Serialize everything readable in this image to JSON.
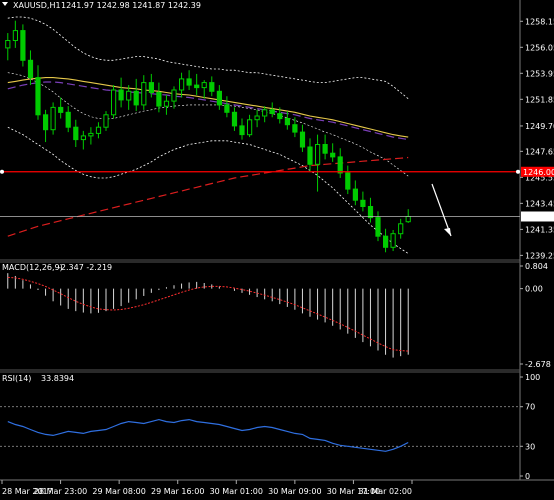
{
  "header": {
    "title": "XAUUSD,H1",
    "ohlc": "1241.97 1242.98 1241.87 1242.39"
  },
  "colors": {
    "background": "#000000",
    "bull": "#00cc00",
    "bear": "#00cc00",
    "ma_fast": "#e6c84a",
    "ma_mid": "#7a3fb8",
    "ma_slow": "#dc1e1e",
    "bands": "#ffffff",
    "support_line": "#ff0000",
    "current_line": "#bbbbbb",
    "rsi": "#2f6fe0",
    "macd_signal": "#ff3030"
  },
  "chart_data": [
    {
      "type": "candlestick",
      "symbol": "XAUUSD",
      "timeframe": "H1",
      "ylim": [
        1239.2,
        1258.9
      ],
      "y_ticks": [
        "1258.15",
        "1256.05",
        "1253.95",
        "1251.85",
        "1249.70",
        "1247.65",
        "1245.55",
        "1243.45",
        "1241.35",
        "1239.25"
      ],
      "x_labels": [
        "28 Mar 2017",
        "28 Mar 23:00",
        "29 Mar 08:00",
        "29 Mar 16:00",
        "30 Mar 01:00",
        "30 Mar 09:00",
        "30 Mar 17:00",
        "31 Mar 02:00"
      ],
      "candles": [
        [
          1256.0,
          1257.2,
          1255.0,
          1256.6
        ],
        [
          1256.6,
          1258.2,
          1256.0,
          1257.4
        ],
        [
          1257.4,
          1257.9,
          1254.5,
          1255.0
        ],
        [
          1255.0,
          1255.8,
          1253.0,
          1253.6
        ],
        [
          1253.6,
          1254.6,
          1250.2,
          1250.6
        ],
        [
          1250.6,
          1251.0,
          1248.4,
          1249.4
        ],
        [
          1249.4,
          1251.6,
          1249.0,
          1251.2
        ],
        [
          1251.2,
          1252.0,
          1250.3,
          1250.8
        ],
        [
          1250.8,
          1251.3,
          1249.2,
          1249.6
        ],
        [
          1249.6,
          1250.2,
          1248.0,
          1248.6
        ],
        [
          1248.6,
          1249.3,
          1247.8,
          1248.9
        ],
        [
          1248.9,
          1249.6,
          1248.2,
          1249.1
        ],
        [
          1249.1,
          1250.0,
          1248.7,
          1249.6
        ],
        [
          1249.6,
          1250.9,
          1249.3,
          1250.6
        ],
        [
          1250.6,
          1253.0,
          1250.3,
          1252.6
        ],
        [
          1252.6,
          1253.6,
          1251.2,
          1251.8
        ],
        [
          1251.8,
          1253.0,
          1251.0,
          1252.5
        ],
        [
          1252.5,
          1253.5,
          1250.9,
          1251.4
        ],
        [
          1251.4,
          1253.8,
          1251.0,
          1253.2
        ],
        [
          1253.2,
          1253.9,
          1252.0,
          1252.4
        ],
        [
          1252.4,
          1253.2,
          1250.8,
          1251.3
        ],
        [
          1251.3,
          1252.2,
          1250.6,
          1251.7
        ],
        [
          1251.7,
          1252.9,
          1251.1,
          1252.6
        ],
        [
          1252.6,
          1254.0,
          1252.0,
          1253.5
        ],
        [
          1253.5,
          1254.2,
          1252.6,
          1253.0
        ],
        [
          1253.0,
          1253.9,
          1252.2,
          1252.8
        ],
        [
          1252.8,
          1253.4,
          1251.9,
          1253.2
        ],
        [
          1253.2,
          1253.7,
          1252.1,
          1252.5
        ],
        [
          1252.5,
          1253.0,
          1251.0,
          1251.4
        ],
        [
          1251.4,
          1252.1,
          1250.4,
          1250.8
        ],
        [
          1250.8,
          1251.2,
          1249.3,
          1249.7
        ],
        [
          1249.7,
          1250.3,
          1248.6,
          1249.0
        ],
        [
          1249.0,
          1250.6,
          1248.8,
          1250.2
        ],
        [
          1250.2,
          1251.0,
          1249.6,
          1250.5
        ],
        [
          1250.5,
          1251.3,
          1250.0,
          1251.0
        ],
        [
          1251.0,
          1251.6,
          1250.4,
          1250.7
        ],
        [
          1250.7,
          1251.2,
          1249.9,
          1250.3
        ],
        [
          1250.3,
          1250.9,
          1249.4,
          1249.8
        ],
        [
          1249.8,
          1250.4,
          1248.8,
          1249.2
        ],
        [
          1249.2,
          1249.8,
          1247.6,
          1248.0
        ],
        [
          1248.0,
          1248.7,
          1246.0,
          1246.6
        ],
        [
          1246.6,
          1249.0,
          1244.4,
          1248.2
        ],
        [
          1248.2,
          1249.0,
          1247.0,
          1247.5
        ],
        [
          1247.5,
          1248.3,
          1246.8,
          1247.2
        ],
        [
          1247.2,
          1247.9,
          1245.5,
          1245.9
        ],
        [
          1245.9,
          1246.5,
          1244.2,
          1244.6
        ],
        [
          1244.6,
          1245.3,
          1243.3,
          1243.7
        ],
        [
          1243.7,
          1244.4,
          1242.8,
          1243.2
        ],
        [
          1243.2,
          1243.9,
          1241.9,
          1242.3
        ],
        [
          1242.3,
          1242.8,
          1240.4,
          1240.8
        ],
        [
          1240.8,
          1241.4,
          1239.5,
          1239.9
        ],
        [
          1239.9,
          1241.3,
          1239.6,
          1241.0
        ],
        [
          1241.0,
          1242.2,
          1240.6,
          1241.8
        ],
        [
          1241.97,
          1242.98,
          1241.87,
          1242.39
        ]
      ],
      "ma_fast": [
        1253.2,
        1253.3,
        1253.4,
        1253.5,
        1253.55,
        1253.6,
        1253.6,
        1253.55,
        1253.5,
        1253.4,
        1253.3,
        1253.2,
        1253.1,
        1253.0,
        1252.9,
        1252.8,
        1252.75,
        1252.7,
        1252.6,
        1252.55,
        1252.5,
        1252.4,
        1252.3,
        1252.25,
        1252.2,
        1252.1,
        1252.0,
        1251.9,
        1251.8,
        1251.7,
        1251.6,
        1251.5,
        1251.4,
        1251.3,
        1251.2,
        1251.1,
        1251.0,
        1250.9,
        1250.8,
        1250.65,
        1250.5,
        1250.4,
        1250.3,
        1250.2,
        1250.05,
        1249.9,
        1249.75,
        1249.6,
        1249.45,
        1249.3,
        1249.15,
        1249.0,
        1248.9,
        1248.8
      ],
      "ma_mid": [
        1252.7,
        1252.85,
        1253.0,
        1253.1,
        1253.2,
        1253.25,
        1253.25,
        1253.2,
        1253.1,
        1253.0,
        1252.9,
        1252.8,
        1252.7,
        1252.6,
        1252.55,
        1252.5,
        1252.45,
        1252.4,
        1252.35,
        1252.3,
        1252.25,
        1252.2,
        1252.1,
        1252.05,
        1252.0,
        1251.9,
        1251.8,
        1251.7,
        1251.6,
        1251.5,
        1251.4,
        1251.3,
        1251.2,
        1251.1,
        1251.0,
        1250.9,
        1250.8,
        1250.7,
        1250.6,
        1250.45,
        1250.3,
        1250.2,
        1250.1,
        1250.0,
        1249.85,
        1249.7,
        1249.55,
        1249.4,
        1249.25,
        1249.1,
        1248.95,
        1248.8,
        1248.7,
        1248.6
      ],
      "ma_slow": [
        1240.8,
        1241.0,
        1241.2,
        1241.4,
        1241.6,
        1241.75,
        1241.9,
        1242.05,
        1242.2,
        1242.35,
        1242.5,
        1242.65,
        1242.8,
        1242.95,
        1243.1,
        1243.25,
        1243.4,
        1243.55,
        1243.7,
        1243.85,
        1244.0,
        1244.15,
        1244.3,
        1244.45,
        1244.6,
        1244.75,
        1244.9,
        1245.05,
        1245.2,
        1245.35,
        1245.5,
        1245.6,
        1245.7,
        1245.8,
        1245.9,
        1246.0,
        1246.1,
        1246.2,
        1246.3,
        1246.4,
        1246.5,
        1246.55,
        1246.6,
        1246.65,
        1246.7,
        1246.75,
        1246.8,
        1246.85,
        1246.9,
        1246.95,
        1247.0,
        1247.05,
        1247.1,
        1247.15
      ],
      "bb_upper": [
        1258.4,
        1258.5,
        1258.5,
        1258.4,
        1258.2,
        1257.9,
        1257.5,
        1257.0,
        1256.5,
        1256.0,
        1255.6,
        1255.3,
        1255.1,
        1255.0,
        1255.0,
        1255.1,
        1255.2,
        1255.3,
        1255.3,
        1255.2,
        1255.1,
        1254.9,
        1254.8,
        1254.7,
        1254.6,
        1254.5,
        1254.4,
        1254.3,
        1254.3,
        1254.2,
        1254.2,
        1254.1,
        1254.0,
        1254.0,
        1253.9,
        1253.8,
        1253.7,
        1253.6,
        1253.5,
        1253.4,
        1253.3,
        1253.2,
        1253.2,
        1253.3,
        1253.4,
        1253.5,
        1253.6,
        1253.6,
        1253.5,
        1253.4,
        1253.3,
        1252.9,
        1252.4,
        1251.9
      ],
      "bb_lower": [
        1249.6,
        1249.3,
        1249.0,
        1248.6,
        1248.2,
        1247.8,
        1247.4,
        1246.9,
        1246.5,
        1246.1,
        1245.8,
        1245.6,
        1245.5,
        1245.5,
        1245.6,
        1245.8,
        1246.0,
        1246.2,
        1246.5,
        1246.8,
        1247.2,
        1247.5,
        1247.8,
        1248.0,
        1248.2,
        1248.3,
        1248.4,
        1248.5,
        1248.5,
        1248.5,
        1248.4,
        1248.3,
        1248.2,
        1248.0,
        1247.8,
        1247.6,
        1247.4,
        1247.1,
        1246.8,
        1246.5,
        1246.1,
        1245.7,
        1245.2,
        1244.7,
        1244.1,
        1243.5,
        1242.9,
        1242.3,
        1241.7,
        1241.2,
        1240.7,
        1240.2,
        1239.8,
        1239.4
      ],
      "bb_mid": [
        1254.0,
        1253.9,
        1253.75,
        1253.5,
        1253.2,
        1252.85,
        1252.45,
        1251.95,
        1251.5,
        1251.05,
        1250.7,
        1250.45,
        1250.3,
        1250.25,
        1250.3,
        1250.45,
        1250.6,
        1250.75,
        1250.9,
        1251.0,
        1251.15,
        1251.2,
        1251.3,
        1251.35,
        1251.4,
        1251.4,
        1251.4,
        1251.4,
        1251.4,
        1251.35,
        1251.3,
        1251.2,
        1251.1,
        1251.0,
        1250.85,
        1250.7,
        1250.55,
        1250.35,
        1250.15,
        1249.95,
        1249.7,
        1249.45,
        1249.2,
        1249.0,
        1248.75,
        1248.5,
        1248.25,
        1247.95,
        1247.6,
        1247.3,
        1247.0,
        1246.55,
        1246.1,
        1245.65
      ],
      "horizontal_level": {
        "value": 1246.0,
        "label": "1246.00"
      },
      "current_price": {
        "value": 1242.39,
        "label": "1242.39"
      }
    },
    {
      "type": "bar",
      "name": "MACD(12,26,9)",
      "header_values": "-2.347 -2.219",
      "ylim": [
        -2.678,
        0.804
      ],
      "y_ticks": [
        "0.804",
        "0.00",
        "-2.678"
      ],
      "histogram": [
        0.55,
        0.45,
        0.3,
        0.15,
        -0.05,
        -0.25,
        -0.45,
        -0.6,
        -0.72,
        -0.8,
        -0.85,
        -0.88,
        -0.86,
        -0.8,
        -0.72,
        -0.62,
        -0.5,
        -0.38,
        -0.26,
        -0.15,
        -0.05,
        0.05,
        0.12,
        0.18,
        0.22,
        0.24,
        0.2,
        0.15,
        0.08,
        0.0,
        -0.08,
        -0.15,
        -0.22,
        -0.3,
        -0.38,
        -0.45,
        -0.55,
        -0.65,
        -0.75,
        -0.88,
        -1.0,
        -1.1,
        -1.2,
        -1.32,
        -1.45,
        -1.6,
        -1.75,
        -1.9,
        -2.05,
        -2.2,
        -2.35,
        -2.45,
        -2.4,
        -2.347
      ],
      "signal": [
        0.4,
        0.38,
        0.33,
        0.26,
        0.18,
        0.08,
        -0.05,
        -0.18,
        -0.32,
        -0.45,
        -0.56,
        -0.65,
        -0.72,
        -0.75,
        -0.76,
        -0.74,
        -0.7,
        -0.64,
        -0.57,
        -0.49,
        -0.4,
        -0.31,
        -0.22,
        -0.13,
        -0.05,
        0.02,
        0.06,
        0.08,
        0.08,
        0.06,
        0.02,
        -0.03,
        -0.09,
        -0.16,
        -0.23,
        -0.31,
        -0.39,
        -0.48,
        -0.57,
        -0.68,
        -0.79,
        -0.9,
        -1.01,
        -1.13,
        -1.25,
        -1.38,
        -1.51,
        -1.65,
        -1.79,
        -1.93,
        -2.06,
        -2.17,
        -2.2,
        -2.219
      ]
    },
    {
      "type": "line",
      "name": "RSI(14)",
      "header_value": "33.8394",
      "ylim": [
        0,
        100
      ],
      "y_ticks": [
        "100",
        "70",
        "30",
        "0"
      ],
      "levels": [
        70,
        30
      ],
      "values": [
        55,
        52,
        50,
        47,
        44,
        42,
        41,
        43,
        45,
        44,
        43,
        45,
        46,
        47,
        50,
        53,
        55,
        54,
        53,
        55,
        57,
        55,
        54,
        56,
        57,
        55,
        54,
        53,
        52,
        50,
        48,
        46,
        47,
        49,
        50,
        49,
        47,
        45,
        43,
        42,
        38,
        37,
        36,
        33,
        31,
        30,
        29,
        28,
        27,
        26,
        25,
        27,
        30,
        33.8394
      ]
    }
  ]
}
